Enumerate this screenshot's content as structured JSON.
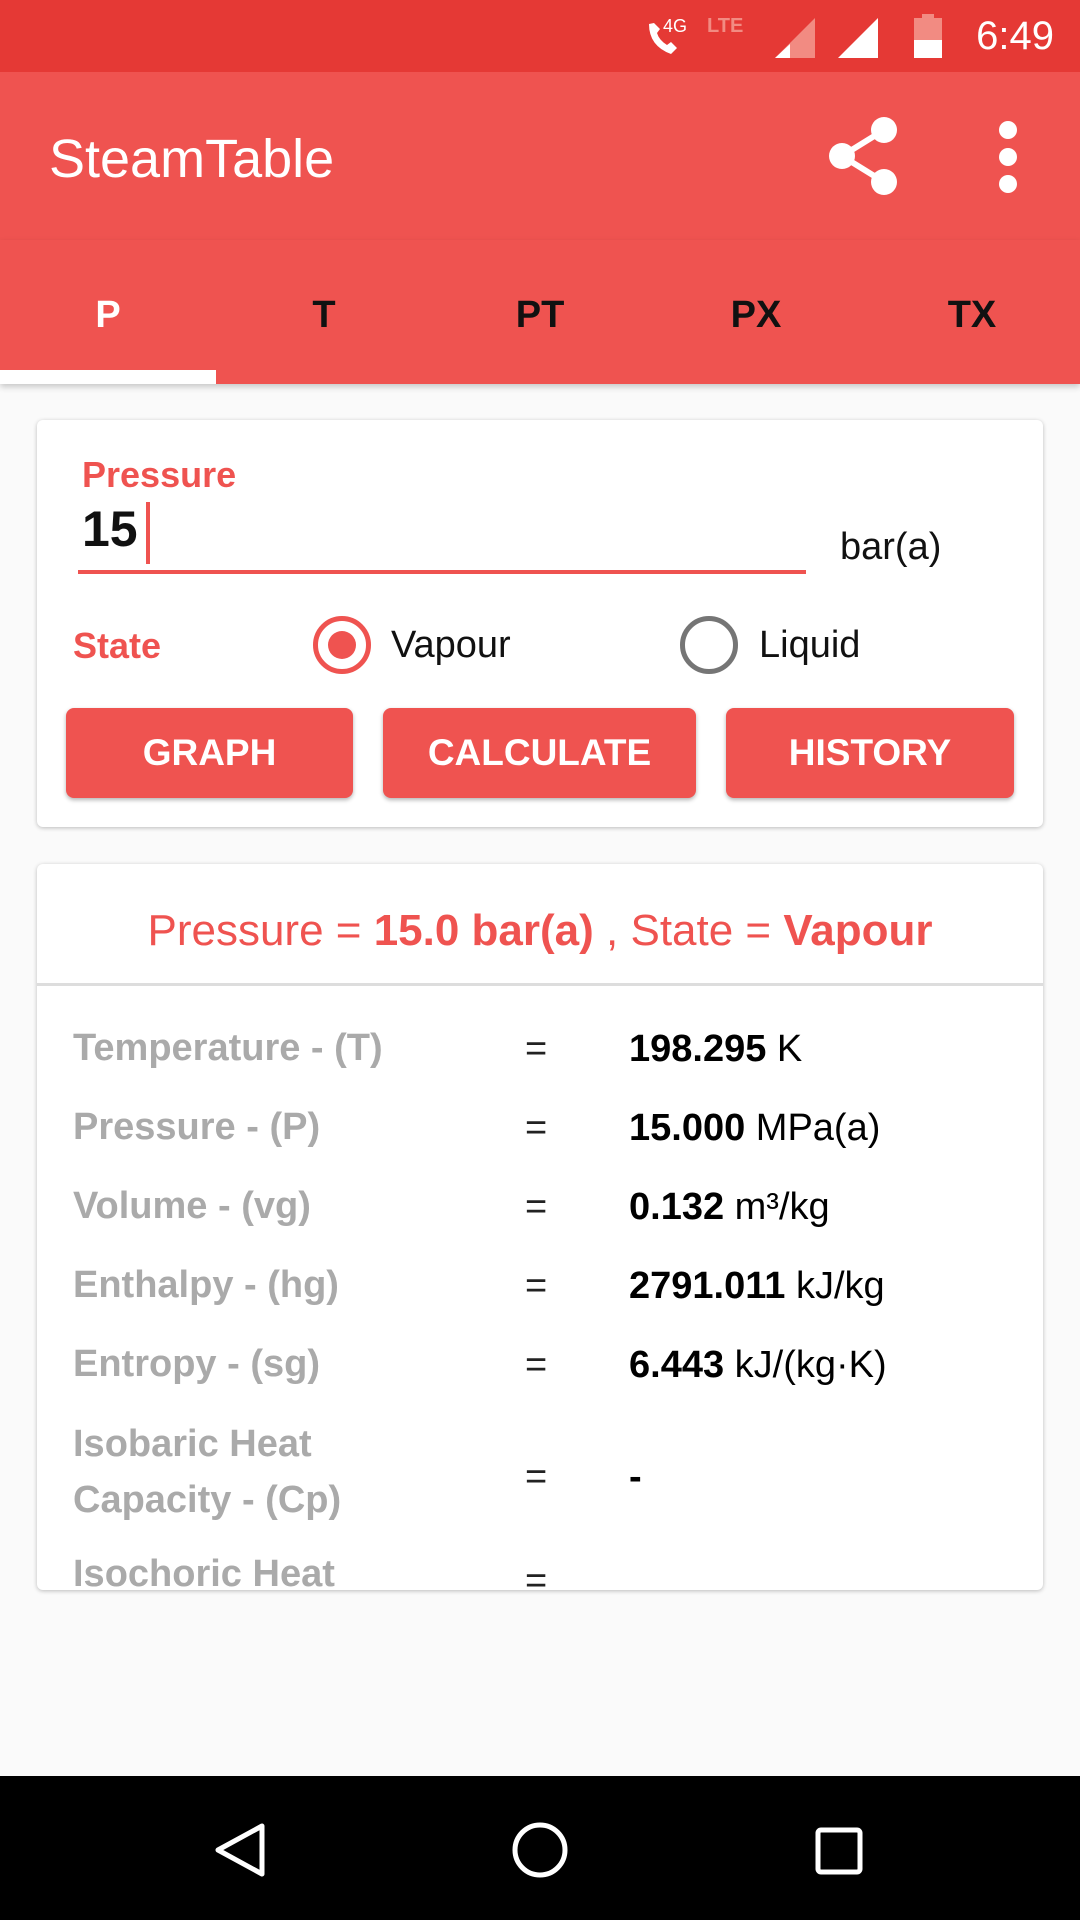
{
  "status_bar": {
    "network": "4G",
    "lte": "LTE",
    "time": "6:49"
  },
  "app_bar": {
    "title": "SteamTable",
    "share_icon": "share-icon",
    "menu_icon": "more-vert-icon"
  },
  "tabs": [
    {
      "label": "P",
      "active": true
    },
    {
      "label": "T"
    },
    {
      "label": "PT"
    },
    {
      "label": "PX"
    },
    {
      "label": "TX"
    }
  ],
  "input": {
    "label": "Pressure",
    "value": "15",
    "unit": "bar(a)",
    "state_label": "State",
    "options": [
      {
        "label": "Vapour",
        "selected": true
      },
      {
        "label": "Liquid",
        "selected": false
      }
    ]
  },
  "buttons": {
    "graph": "GRAPH",
    "calculate": "CALCULATE",
    "history": "HISTORY"
  },
  "result": {
    "header": {
      "p_prefix": "Pressure = ",
      "p_value": "15.0 bar(a)",
      "s_prefix": " , State = ",
      "s_value": "Vapour"
    },
    "rows": [
      {
        "label": "Temperature - (T)",
        "eq": "=",
        "value": "198.295",
        "unit": " K"
      },
      {
        "label": "Pressure - (P)",
        "eq": "=",
        "value": "15.000",
        "unit": " MPa(a)"
      },
      {
        "label": "Volume - (vg)",
        "eq": "=",
        "value": "0.132",
        "unit": " m³/kg"
      },
      {
        "label": "Enthalpy - (hg)",
        "eq": "=",
        "value": "2791.011",
        "unit": " kJ/kg"
      },
      {
        "label": "Entropy - (sg)",
        "eq": "=",
        "value": "6.443",
        "unit": " kJ/(kg·K)"
      },
      {
        "label": "Isobaric Heat Capacity - (Cp)",
        "eq": "=",
        "value": "-",
        "unit": ""
      },
      {
        "label": "Isochoric Heat",
        "eq": "=",
        "value": "",
        "unit": ""
      }
    ]
  },
  "colors": {
    "primary": "#ef5350",
    "status": "#e53935"
  }
}
